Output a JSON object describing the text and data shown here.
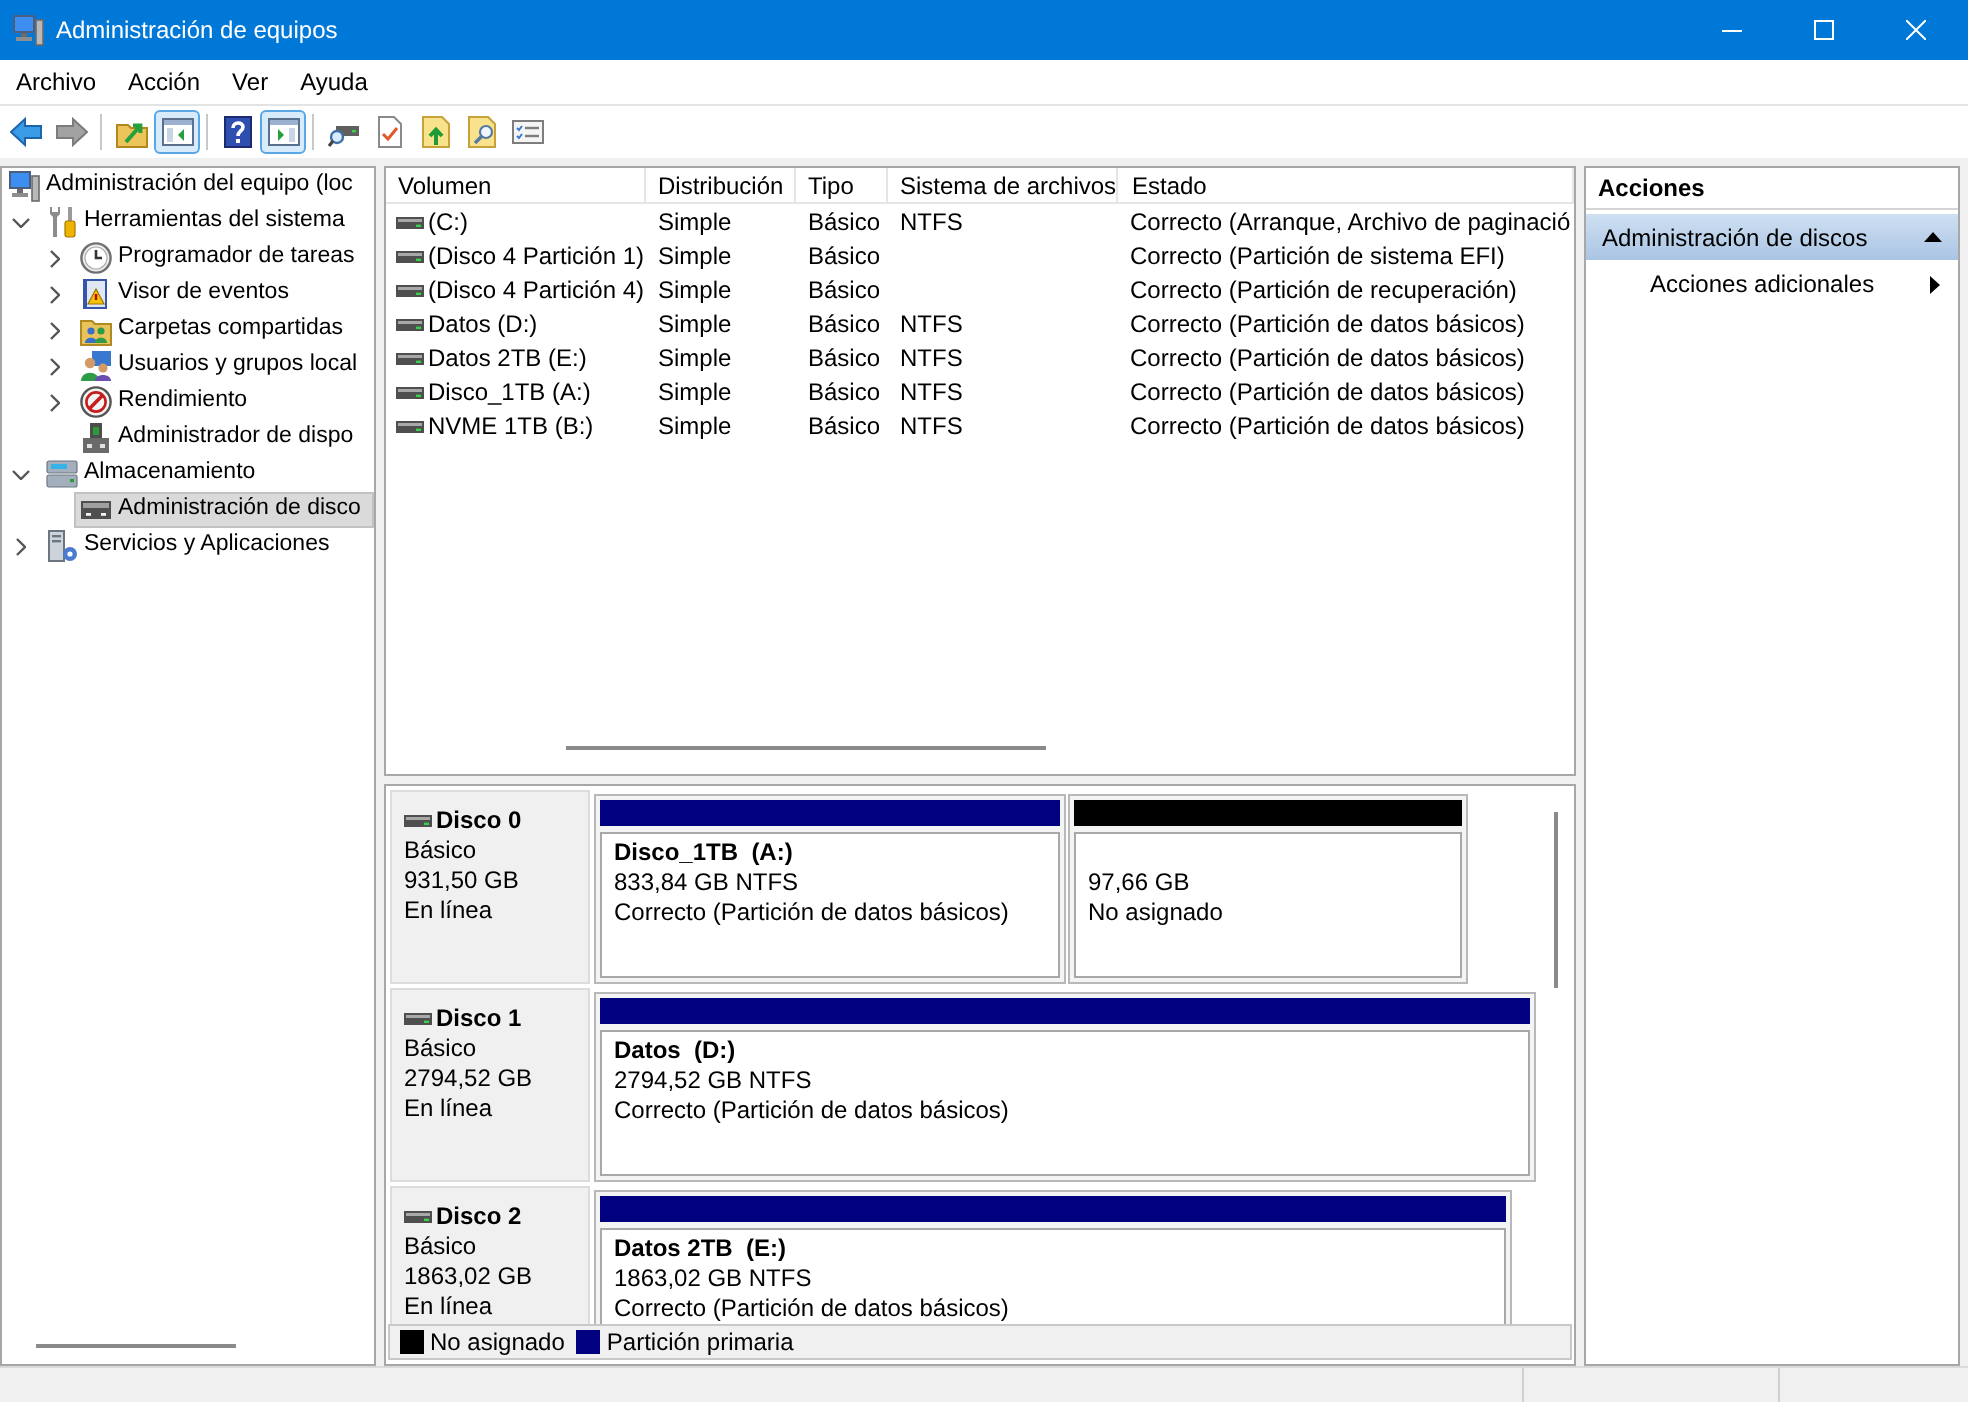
{
  "window": {
    "title": "Administración de equipos"
  },
  "menu": [
    {
      "label": "Archivo"
    },
    {
      "label": "Acción"
    },
    {
      "label": "Ver"
    },
    {
      "label": "Ayuda"
    }
  ],
  "toolbar": [
    {
      "on": false,
      "disabled": false
    },
    {
      "on": false,
      "disabled": true
    },
    {
      "on": false,
      "disabled": false
    },
    {
      "on": true,
      "disabled": false
    },
    {
      "on": false,
      "disabled": false
    },
    {
      "on": true,
      "disabled": false
    },
    {
      "on": false,
      "disabled": false
    },
    {
      "on": false,
      "disabled": false
    },
    {
      "on": false,
      "disabled": false
    },
    {
      "on": false,
      "disabled": false
    },
    {
      "on": false,
      "disabled": false
    }
  ],
  "tree": [
    {
      "label": "Administración del equipo (loc",
      "kind": "computer",
      "expandable": false,
      "selected": false,
      "children": [
        {
          "label": "Herramientas del sistema",
          "kind": "tools",
          "expandable": true,
          "expanded": true,
          "selected": false,
          "children": [
            {
              "label": "Programador de tareas",
              "kind": "scheduler",
              "expandable": true,
              "expanded": false,
              "selected": false
            },
            {
              "label": "Visor de eventos",
              "kind": "event-viewer",
              "expandable": true,
              "expanded": false,
              "selected": false
            },
            {
              "label": "Carpetas compartidas",
              "kind": "shared-folders",
              "expandable": true,
              "expanded": false,
              "selected": false
            },
            {
              "label": "Usuarios y grupos local",
              "kind": "users",
              "expandable": true,
              "expanded": false,
              "selected": false
            },
            {
              "label": "Rendimiento",
              "kind": "performance",
              "expandable": true,
              "expanded": false,
              "selected": false
            },
            {
              "label": "Administrador de dispo",
              "kind": "device-manager",
              "expandable": false,
              "selected": false
            }
          ]
        },
        {
          "label": "Almacenamiento",
          "kind": "storage",
          "expandable": true,
          "expanded": true,
          "selected": false,
          "children": [
            {
              "label": "Administración de disco",
              "kind": "disk-management",
              "expandable": false,
              "selected": true
            }
          ]
        },
        {
          "label": "Servicios y Aplicaciones",
          "kind": "services",
          "expandable": true,
          "expanded": false,
          "selected": false
        }
      ]
    }
  ],
  "volumes": {
    "columns": [
      "Volumen",
      "Distribución",
      "Tipo",
      "Sistema de archivos",
      "Estado"
    ],
    "rows": [
      {
        "volume": "(C:)",
        "layout": "Simple",
        "type": "Básico",
        "file_system": "NTFS",
        "status": "Correcto (Arranque, Archivo de paginació"
      },
      {
        "volume": "(Disco 4 Partición 1)",
        "layout": "Simple",
        "type": "Básico",
        "status": "Correcto (Partición de sistema EFI)"
      },
      {
        "volume": "(Disco 4 Partición 4)",
        "layout": "Simple",
        "type": "Básico",
        "status": "Correcto (Partición de recuperación)"
      },
      {
        "volume": "Datos (D:)",
        "layout": "Simple",
        "type": "Básico",
        "file_system": "NTFS",
        "status": "Correcto (Partición de datos básicos)"
      },
      {
        "volume": "Datos 2TB (E:)",
        "layout": "Simple",
        "type": "Básico",
        "file_system": "NTFS",
        "status": "Correcto (Partición de datos básicos)"
      },
      {
        "volume": "Disco_1TB (A:)",
        "layout": "Simple",
        "type": "Básico",
        "file_system": "NTFS",
        "status": "Correcto (Partición de datos básicos)"
      },
      {
        "volume": "NVME 1TB (B:)",
        "layout": "Simple",
        "type": "Básico",
        "file_system": "NTFS",
        "status": "Correcto (Partición de datos básicos)"
      }
    ]
  },
  "disks": [
    {
      "name": "Disco 0",
      "type": "Básico",
      "size": "931,50 GB",
      "status": "En línea",
      "partitions": [
        {
          "color": "#000080",
          "label": "Disco_1TB  (A:)",
          "size": "833,84 GB NTFS",
          "status": "Correcto (Partición de datos básicos)"
        },
        {
          "color": "#000000",
          "size": "97,66 GB",
          "status": "No asignado"
        }
      ]
    },
    {
      "name": "Disco 1",
      "type": "Básico",
      "size": "2794,52 GB",
      "status": "En línea",
      "partitions": [
        {
          "color": "#000080",
          "label": "Datos  (D:)",
          "size": "2794,52 GB NTFS",
          "status": "Correcto (Partición de datos básicos)"
        }
      ]
    },
    {
      "name": "Disco 2",
      "type": "Básico",
      "size": "1863,02 GB",
      "status": "En línea",
      "partitions": [
        {
          "color": "#000080",
          "label": "Datos 2TB  (E:)",
          "size": "1863,02 GB NTFS",
          "status": "Correcto (Partición de datos básicos)"
        }
      ]
    }
  ],
  "legend": [
    {
      "label": "No asignado",
      "color": "#000000"
    },
    {
      "label": "Partición primaria",
      "color": "#000080"
    }
  ],
  "actions": {
    "title": "Acciones",
    "sections": [
      {
        "label": "Administración de discos",
        "expanded": true,
        "items": [
          {
            "label": "Acciones adicionales",
            "submenu": true
          }
        ]
      }
    ]
  }
}
